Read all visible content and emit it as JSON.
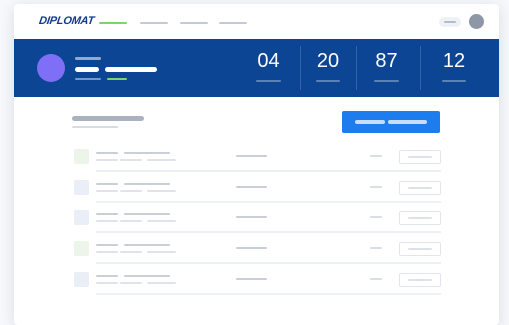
{
  "app": {
    "logo_text": "DIPLOMAT",
    "brand_color": "#0c4594",
    "accent_color": "#7ed36f",
    "primary_color": "#1d7dee"
  },
  "nav": {
    "items": [
      {
        "state": "active"
      },
      {
        "state": "inactive"
      },
      {
        "state": "inactive"
      },
      {
        "state": "inactive"
      }
    ],
    "utility": {
      "icon": "toggle-pill"
    },
    "user": {
      "icon": "avatar"
    }
  },
  "profile": {
    "avatar_color": "#7e6ff6"
  },
  "stats": [
    {
      "value": "04"
    },
    {
      "value": "20"
    },
    {
      "value": "87"
    },
    {
      "value": "12"
    }
  ],
  "list": {
    "rows": [
      {
        "checkbox_color": "#edf5ea"
      },
      {
        "checkbox_color": "#eaeef6"
      },
      {
        "checkbox_color": "#eaeef6"
      },
      {
        "checkbox_color": "#edf5ea"
      },
      {
        "checkbox_color": "#eaeef6"
      }
    ]
  }
}
